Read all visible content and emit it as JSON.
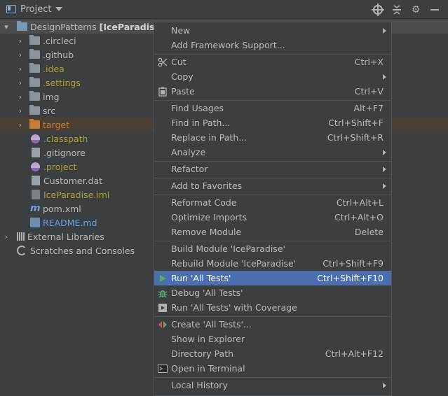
{
  "toolbar": {
    "title": "Project",
    "icons": [
      "project-icon",
      "chevron-down-icon",
      "locate-target-icon",
      "collapse-all-icon",
      "gear-icon",
      "hide-icon"
    ]
  },
  "tree": {
    "root": {
      "name": "DesignPatterns",
      "module": "[IceParadise]"
    },
    "items": [
      {
        "label": ".circleci",
        "kind": "folder"
      },
      {
        "label": ".github",
        "kind": "folder"
      },
      {
        "label": ".idea",
        "kind": "folder"
      },
      {
        "label": ".settings",
        "kind": "folder"
      },
      {
        "label": "img",
        "kind": "folder"
      },
      {
        "label": "src",
        "kind": "folder"
      },
      {
        "label": "target",
        "kind": "folder"
      },
      {
        "label": ".classpath",
        "kind": "file"
      },
      {
        "label": ".gitignore",
        "kind": "file"
      },
      {
        "label": ".project",
        "kind": "file"
      },
      {
        "label": "Customer.dat",
        "kind": "file"
      },
      {
        "label": "IceParadise.iml",
        "kind": "file"
      },
      {
        "label": "pom.xml",
        "kind": "file"
      },
      {
        "label": "README.md",
        "kind": "file"
      }
    ],
    "external_libraries": "External Libraries",
    "scratches": "Scratches and Consoles"
  },
  "menu": {
    "items": [
      {
        "label": "New",
        "shortcut": "",
        "submenu": true
      },
      {
        "label": "Add Framework Support...",
        "shortcut": ""
      },
      {
        "label": "Cut",
        "shortcut": "Ctrl+X",
        "icon": "scissors-icon"
      },
      {
        "label": "Copy",
        "shortcut": "",
        "submenu": true
      },
      {
        "label": "Paste",
        "shortcut": "Ctrl+V",
        "icon": "clipboard-icon"
      },
      {
        "label": "Find Usages",
        "shortcut": "Alt+F7"
      },
      {
        "label": "Find in Path...",
        "shortcut": "Ctrl+Shift+F"
      },
      {
        "label": "Replace in Path...",
        "shortcut": "Ctrl+Shift+R"
      },
      {
        "label": "Analyze",
        "shortcut": "",
        "submenu": true
      },
      {
        "label": "Refactor",
        "shortcut": "",
        "submenu": true
      },
      {
        "label": "Add to Favorites",
        "shortcut": "",
        "submenu": true
      },
      {
        "label": "Reformat Code",
        "shortcut": "Ctrl+Alt+L"
      },
      {
        "label": "Optimize Imports",
        "shortcut": "Ctrl+Alt+O"
      },
      {
        "label": "Remove Module",
        "shortcut": "Delete"
      },
      {
        "label": "Build Module 'IceParadise'",
        "shortcut": ""
      },
      {
        "label": "Rebuild Module 'IceParadise'",
        "shortcut": "Ctrl+Shift+F9"
      },
      {
        "label": "Run 'All Tests'",
        "shortcut": "Ctrl+Shift+F10",
        "icon": "run-icon"
      },
      {
        "label": "Debug 'All Tests'",
        "shortcut": "",
        "icon": "debug-bug-icon"
      },
      {
        "label": "Run 'All Tests' with Coverage",
        "shortcut": "",
        "icon": "coverage-icon"
      },
      {
        "label": "Create 'All Tests'...",
        "shortcut": "",
        "icon": "create-config-icon"
      },
      {
        "label": "Show in Explorer",
        "shortcut": ""
      },
      {
        "label": "Directory Path",
        "shortcut": "Ctrl+Alt+F12"
      },
      {
        "label": "Open in Terminal",
        "shortcut": "",
        "icon": "terminal-icon"
      },
      {
        "label": "Local History",
        "shortcut": "",
        "submenu": true
      }
    ]
  },
  "colors": {
    "background": "#3c3f41",
    "selection": "#4b6eaf",
    "excluded_folder": "#c57e3a",
    "ignored_text": "#a89f3d",
    "link_text": "#6e9fd8"
  }
}
